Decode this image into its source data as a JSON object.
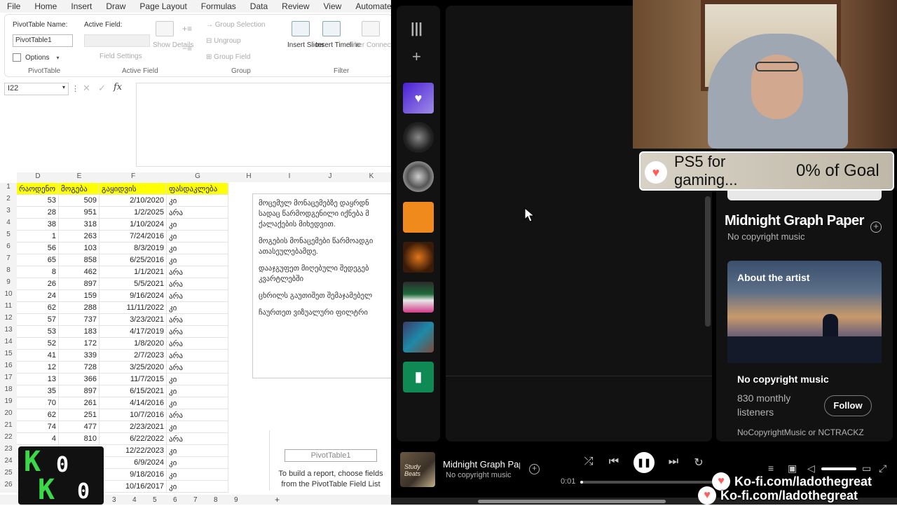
{
  "excel": {
    "menu": [
      "File",
      "Home",
      "Insert",
      "Draw",
      "Page Layout",
      "Formulas",
      "Data",
      "Review",
      "View",
      "Automate"
    ],
    "ribbon": {
      "pivottable_name_label": "PivotTable Name:",
      "pivottable_name_value": "PivotTable1",
      "options_label": "Options",
      "group_pivottable": "PivotTable",
      "active_field_label": "Active Field:",
      "field_settings_label": "Field Settings",
      "show_details_label": "Show Details",
      "group_active_field": "Active Field",
      "group_selection_label": "Group Selection",
      "ungroup_label": "Ungroup",
      "group_field_label": "Group Field",
      "group_group": "Group",
      "insert_slicer_label": "Insert Slicer",
      "insert_timeline_label": "Insert Timeline",
      "filter_connections_label": "Filter Connections",
      "group_filter": "Filter"
    },
    "name_box": "I22",
    "fx_label": "fx",
    "columns": [
      "D",
      "E",
      "F",
      "G",
      "H",
      "I",
      "J",
      "K"
    ],
    "headers": [
      "რაოდენო",
      "მოგება",
      "გაყიდვის",
      "ფასდაკლება"
    ],
    "rows": [
      [
        "53",
        "509",
        "2/10/2020",
        "კი"
      ],
      [
        "28",
        "951",
        "1/2/2025",
        "არა"
      ],
      [
        "38",
        "318",
        "1/10/2024",
        "კი"
      ],
      [
        "1",
        "263",
        "7/24/2016",
        "კი"
      ],
      [
        "56",
        "103",
        "8/3/2019",
        "კი"
      ],
      [
        "65",
        "858",
        "6/25/2016",
        "კი"
      ],
      [
        "8",
        "462",
        "1/1/2021",
        "არა"
      ],
      [
        "26",
        "897",
        "5/5/2021",
        "არა"
      ],
      [
        "24",
        "159",
        "9/16/2024",
        "არა"
      ],
      [
        "62",
        "288",
        "11/11/2022",
        "კი"
      ],
      [
        "57",
        "737",
        "3/23/2021",
        "არა"
      ],
      [
        "53",
        "183",
        "4/17/2019",
        "არა"
      ],
      [
        "52",
        "172",
        "1/8/2020",
        "არა"
      ],
      [
        "41",
        "339",
        "2/7/2023",
        "არა"
      ],
      [
        "12",
        "728",
        "3/25/2020",
        "არა"
      ],
      [
        "13",
        "366",
        "11/7/2015",
        "კი"
      ],
      [
        "35",
        "897",
        "6/15/2021",
        "კი"
      ],
      [
        "70",
        "261",
        "4/14/2016",
        "კი"
      ],
      [
        "62",
        "251",
        "10/7/2016",
        "არა"
      ],
      [
        "74",
        "477",
        "2/23/2021",
        "კი"
      ],
      [
        "4",
        "810",
        "6/22/2022",
        "არა"
      ],
      [
        "",
        "980",
        "12/22/2023",
        "კი"
      ],
      [
        "",
        "133",
        "6/9/2024",
        "კი"
      ],
      [
        "",
        "",
        "9/18/2016",
        "კი"
      ],
      [
        "",
        "",
        "10/16/2017",
        "კი"
      ]
    ],
    "row_numbers": [
      "1",
      "2",
      "3",
      "4",
      "5",
      "6",
      "7",
      "8",
      "9",
      "10",
      "11",
      "12",
      "13",
      "14",
      "15",
      "16",
      "17",
      "18",
      "19",
      "20",
      "21",
      "22",
      "23",
      "24",
      "25",
      "26"
    ],
    "notes": [
      "მოცემულ მონაცემებზე დაყრდნ სადაც წარმოდგენილი იქნება მ ქალაქების მიხედვით.",
      "მოგების მონაცემები წარმოადგი ათასეულებამდე.",
      "დააჯგუფეთ მიღებული შედეგებ კვარტლებში",
      "ცხრილს გაუთიშეთ შემაჯამებელ",
      "ჩაურთეთ ვიზუალური ფილტრი"
    ],
    "pivot_placeholder": "PivotTable1",
    "pivot_hint": "To build a report, choose fields from the PivotTable Field List",
    "sheet_tabs": [
      "3",
      "4",
      "5",
      "6",
      "7",
      "8",
      "9"
    ],
    "add_sheet": "+"
  },
  "logo": {
    "k1": "K",
    "z1": "0",
    "k2": "K",
    "z2": "0"
  },
  "spotify": {
    "song_title": "Midnight Graph Paper",
    "song_artist": "No copyright music",
    "about_title": "About the artist",
    "artist_name": "No copyright music",
    "listeners": "830 monthly listeners",
    "follow_label": "Follow",
    "artist_desc": "NoCopyrightMusic or NCTRACKZ",
    "player": {
      "title": "Midnight Graph Paper",
      "artist": "No copyright music",
      "time_current": "0:01",
      "progress": 0.02,
      "album_text": "Study Beats"
    }
  },
  "stream": {
    "goal_text": "PS5 for gaming...",
    "goal_pct": "0% of Goal",
    "kofi_1": "Ko-fi.com/ladothegreat",
    "kofi_2": "Ko-fi.com/ladothegreat"
  },
  "colors": {
    "spotify_bg": "#121212",
    "excel_header_fill": "#ffff00",
    "logo_green": "#3bd94a",
    "kofi_red": "#ff5e5b"
  }
}
